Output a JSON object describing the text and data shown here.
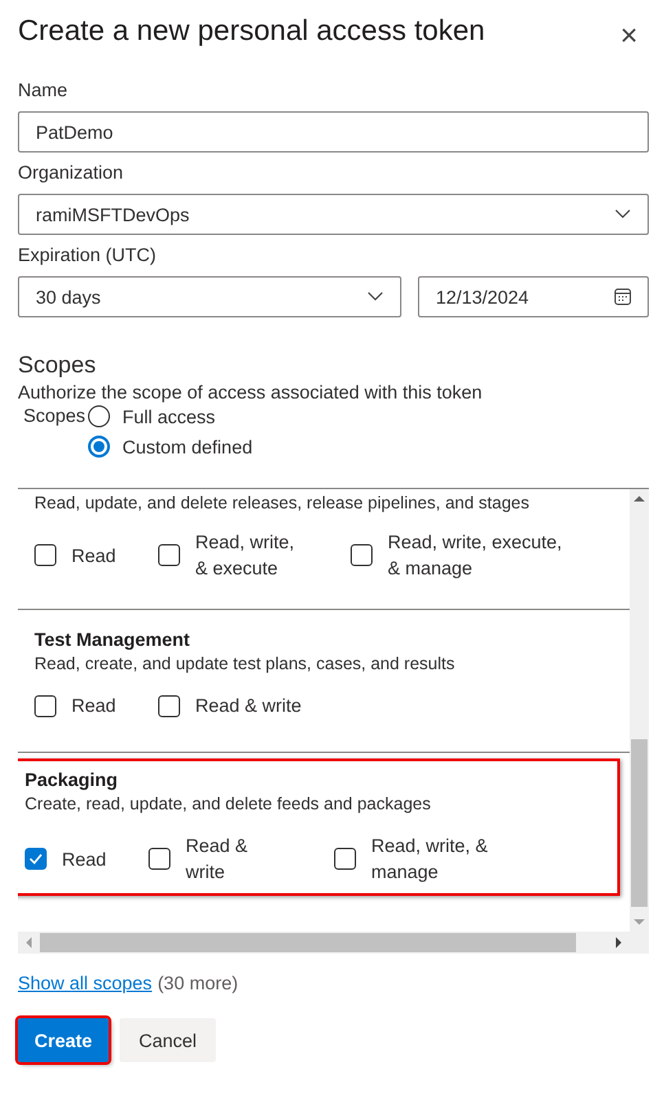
{
  "dialog": {
    "title": "Create a new personal access token",
    "close": "×"
  },
  "fields": [
    {
      "kind": "text",
      "label": "Name",
      "value": "PatDemo"
    },
    {
      "kind": "select",
      "label": "Organization",
      "value": "ramiMSFTDevOps"
    }
  ],
  "expiration": {
    "label": "Expiration (UTC)",
    "duration": "30 days",
    "date": "12/13/2024"
  },
  "scopes": {
    "heading": "Scopes",
    "description": "Authorize the scope of access associated with this token",
    "label": "Scopes",
    "options": [
      {
        "label": "Full access",
        "selected": false
      },
      {
        "label": "Custom defined",
        "selected": true
      }
    ]
  },
  "scope_groups": [
    {
      "description": "Read, update, and delete releases, release pipelines, and stages",
      "highlighted": false,
      "options": [
        {
          "label": "Read",
          "checked": false
        },
        {
          "label": "Read, write,\n& execute",
          "checked": false
        },
        {
          "label": "Read, write, execute,\n& manage",
          "checked": false
        }
      ]
    },
    {
      "title": "Test Management",
      "description": "Read, create, and update test plans, cases, and results",
      "highlighted": false,
      "options": [
        {
          "label": "Read",
          "checked": false
        },
        {
          "label": "Read & write",
          "checked": false
        }
      ]
    },
    {
      "title": "Packaging",
      "description": "Create, read, update, and delete feeds and packages",
      "highlighted": true,
      "options": [
        {
          "label": "Read",
          "checked": true
        },
        {
          "label": "Read &\nwrite",
          "checked": false
        },
        {
          "label": "Read, write, &\nmanage",
          "checked": false
        }
      ]
    }
  ],
  "show_all": {
    "link": "Show all scopes",
    "count": "(30 more)"
  },
  "buttons": [
    {
      "label": "Create",
      "kind": "primary",
      "highlighted": true
    },
    {
      "label": "Cancel",
      "kind": "secondary",
      "highlighted": false
    }
  ]
}
